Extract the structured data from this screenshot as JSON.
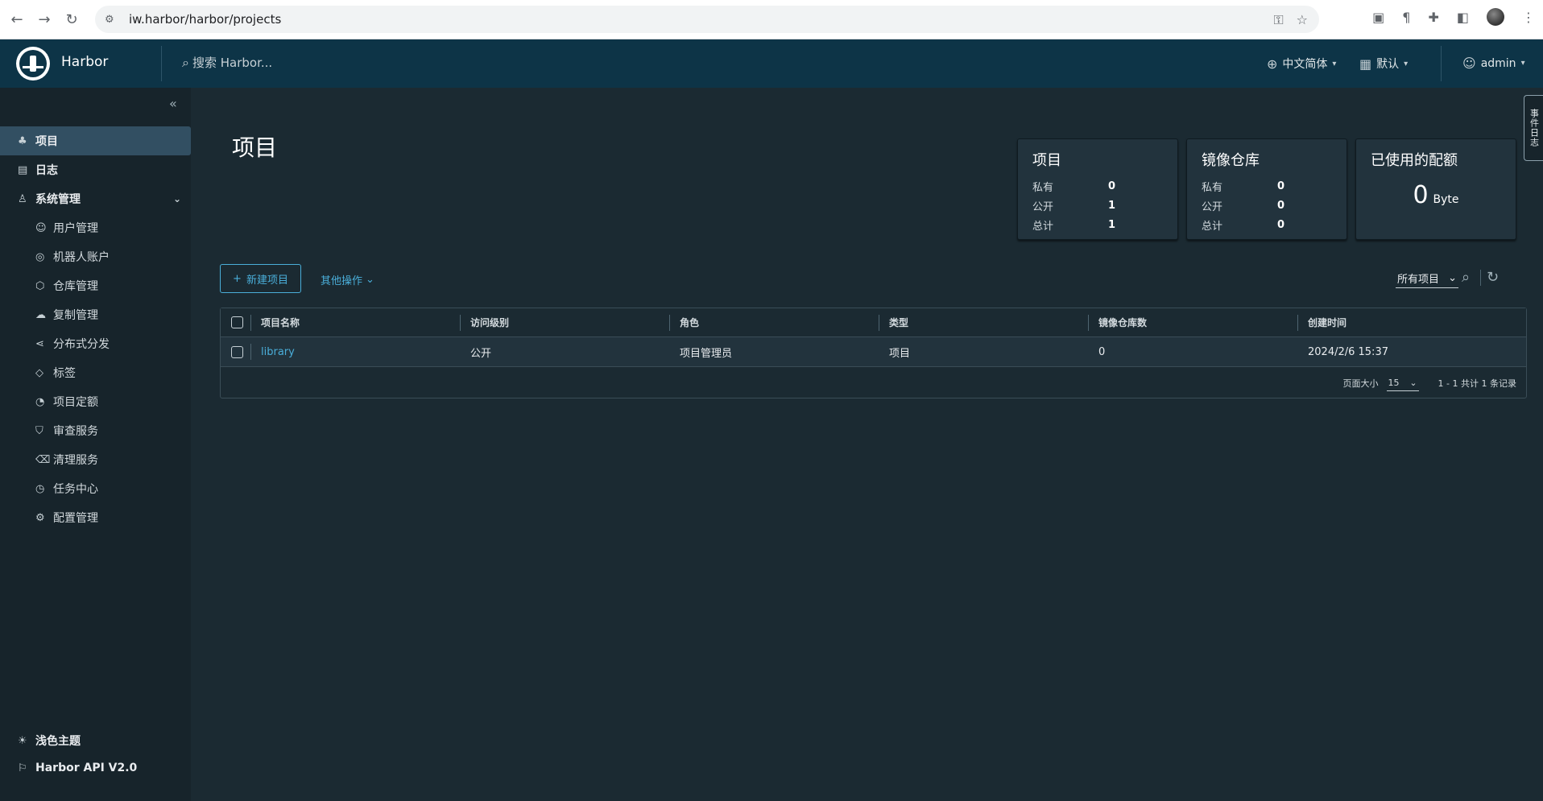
{
  "browser": {
    "url": "iw.harbor/harbor/projects"
  },
  "header": {
    "brand": "Harbor",
    "search_placeholder": "搜索 Harbor...",
    "language": "中文简体",
    "date_format": "默认",
    "user": "admin",
    "event_tab": "事件日志"
  },
  "sidebar": {
    "items": [
      {
        "label": "项目",
        "icon": "projects-icon"
      },
      {
        "label": "日志",
        "icon": "log-icon"
      },
      {
        "label": "系统管理",
        "icon": "admin-icon"
      }
    ],
    "sub_items": [
      {
        "label": "用户管理",
        "icon": "users-icon"
      },
      {
        "label": "机器人账户",
        "icon": "robot-icon"
      },
      {
        "label": "仓库管理",
        "icon": "registry-icon"
      },
      {
        "label": "复制管理",
        "icon": "replication-icon"
      },
      {
        "label": "分布式分发",
        "icon": "distribution-icon"
      },
      {
        "label": "标签",
        "icon": "tag-icon"
      },
      {
        "label": "项目定额",
        "icon": "quota-icon"
      },
      {
        "label": "审查服务",
        "icon": "shield-icon"
      },
      {
        "label": "清理服务",
        "icon": "trash-icon"
      },
      {
        "label": "任务中心",
        "icon": "dashboard-icon"
      },
      {
        "label": "配置管理",
        "icon": "gear-icon"
      }
    ],
    "theme": "浅色主题",
    "api": "Harbor API V2.0"
  },
  "main": {
    "title": "项目",
    "cards": {
      "projects": {
        "title": "项目",
        "private_label": "私有",
        "private": "0",
        "public_label": "公开",
        "public": "1",
        "total_label": "总计",
        "total": "1"
      },
      "repos": {
        "title": "镜像仓库",
        "private_label": "私有",
        "private": "0",
        "public_label": "公开",
        "public": "0",
        "total_label": "总计",
        "total": "0"
      },
      "quota": {
        "title": "已使用的配额",
        "value": "0",
        "unit": "Byte"
      }
    },
    "new_project": "新建项目",
    "other_actions": "其他操作",
    "filter": "所有项目",
    "table": {
      "headers": [
        "项目名称",
        "访问级别",
        "角色",
        "类型",
        "镜像仓库数",
        "创建时间"
      ],
      "rows": [
        [
          "library",
          "公开",
          "项目管理员",
          "项目",
          "0",
          "2024/2/6 15:37"
        ]
      ],
      "page_size_label": "页面大小",
      "page_size": "15",
      "summary": "1 - 1 共计 1 条记录"
    }
  },
  "colors": {
    "header_bg": "#0d3447",
    "sidebar_bg": "#17242b",
    "main_bg": "#1b2a32",
    "accent": "#4aaed9"
  }
}
